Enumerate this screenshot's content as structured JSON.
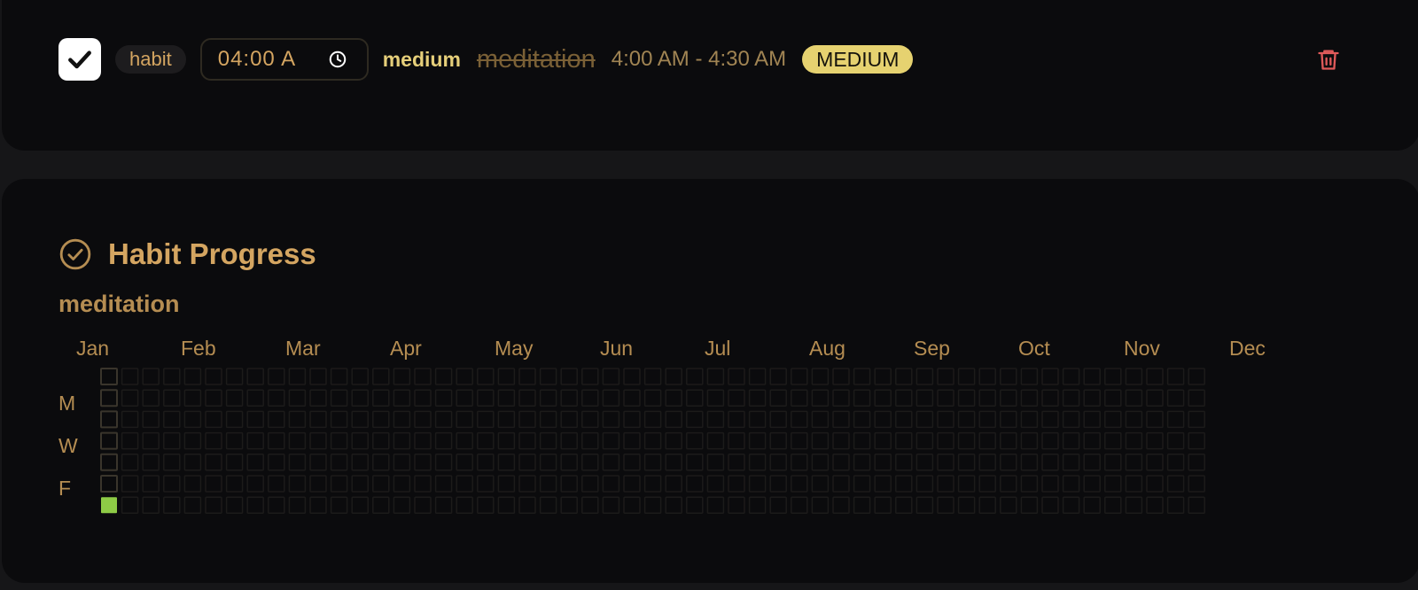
{
  "task": {
    "checked": true,
    "tag": "habit",
    "time_input_value": "04:00  A",
    "priority_word": "medium",
    "name": "meditation",
    "time_range": "4:00 AM - 4:30 AM",
    "priority_badge": "MEDIUM",
    "icons": {
      "check": "check-icon",
      "clock": "clock-icon",
      "delete": "trash-icon"
    },
    "colors": {
      "badge_bg": "#e6d270",
      "priority_word": "#e6cf7a",
      "delete": "#e05a5a"
    }
  },
  "habit_progress": {
    "title": "Habit Progress",
    "icon": "check-circle-icon",
    "habit_name": "meditation",
    "months": [
      "Jan",
      "Feb",
      "Mar",
      "Apr",
      "May",
      "Jun",
      "Jul",
      "Aug",
      "Sep",
      "Oct",
      "Nov",
      "Dec"
    ],
    "day_labels": [
      "M",
      "W",
      "F"
    ],
    "weeks_shown": 53,
    "days_per_week": 7,
    "completed_cells": [
      {
        "week": 0,
        "day": 6
      }
    ],
    "colors": {
      "completed": "#8ecb46",
      "cell_border_first_week": "#3a352c",
      "cell_border": "#1c1b1a"
    }
  }
}
